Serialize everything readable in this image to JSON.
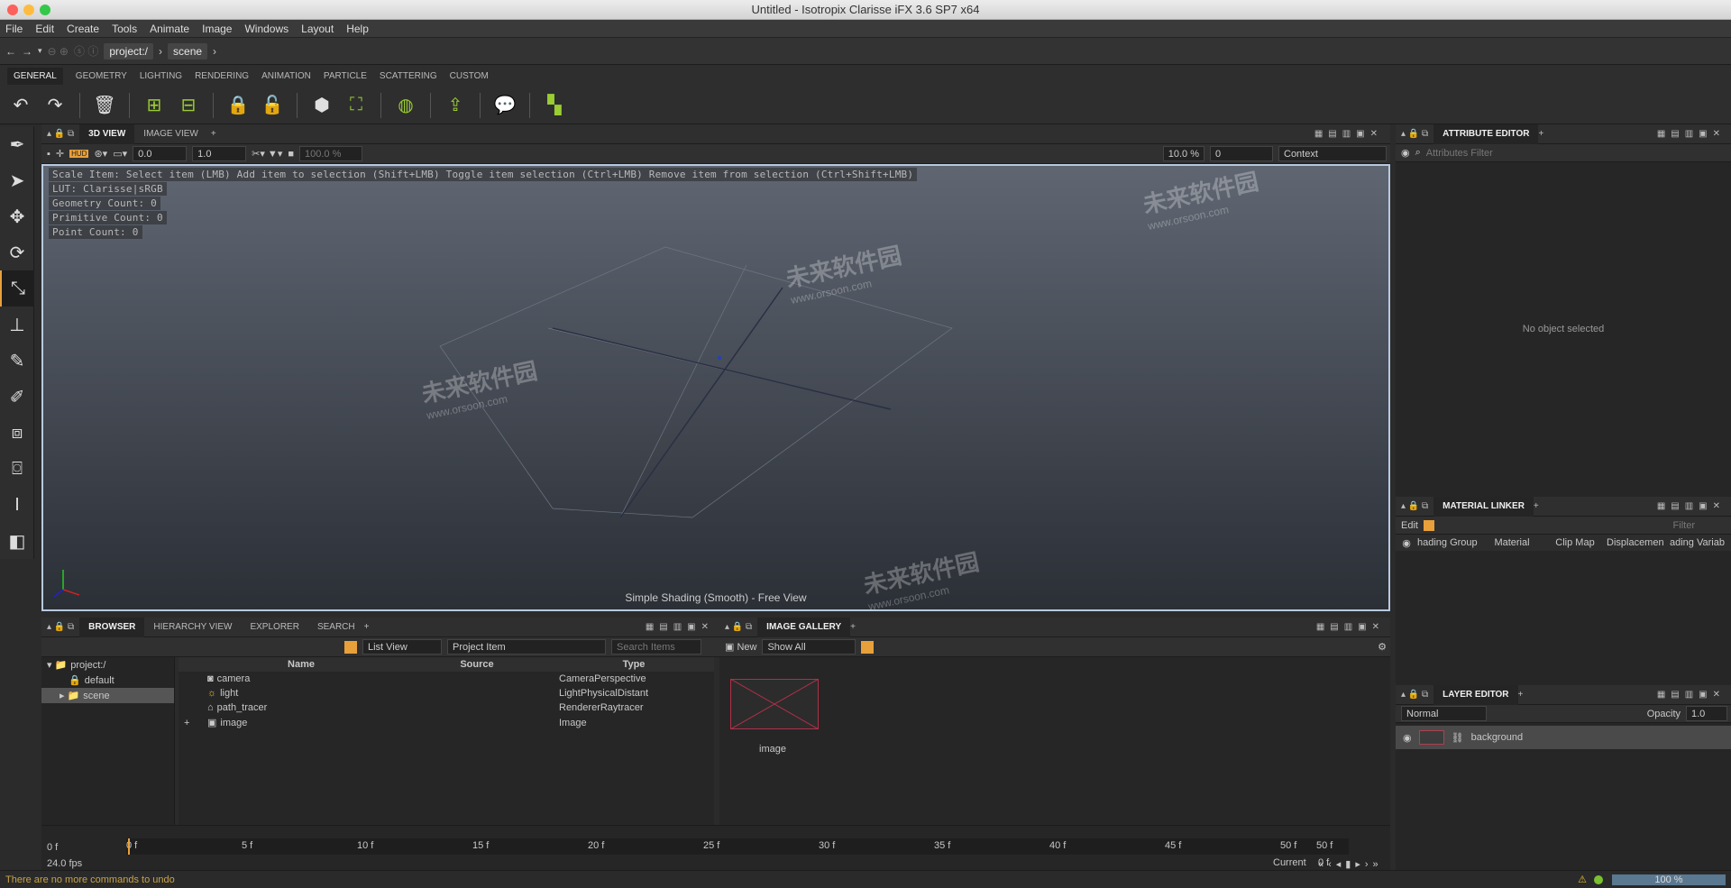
{
  "window": {
    "title": "Untitled - Isotropix Clarisse iFX 3.6 SP7 x64"
  },
  "menu": [
    "File",
    "Edit",
    "Create",
    "Tools",
    "Animate",
    "Image",
    "Windows",
    "Layout",
    "Help"
  ],
  "address": {
    "crumbs": [
      "project:/",
      "scene"
    ]
  },
  "shelf_tabs": [
    "GENERAL",
    "GEOMETRY",
    "LIGHTING",
    "RENDERING",
    "ANIMATION",
    "PARTICLE",
    "SCATTERING",
    "CUSTOM"
  ],
  "view_tabs": [
    "3D VIEW",
    "IMAGE VIEW"
  ],
  "view_toolbar": {
    "v1": "0.0",
    "v2": "1.0",
    "v3": "100.0 %",
    "pct": "10.0 %",
    "frame": "0",
    "context": "Context"
  },
  "hud": {
    "hint": "Scale Item: Select item (LMB)  Add item to selection (Shift+LMB)  Toggle item selection (Ctrl+LMB)  Remove item from selection (Ctrl+Shift+LMB)",
    "lut": "LUT: Clarisse|sRGB",
    "geometry": "Geometry Count: 0",
    "primitive": "Primitive Count: 0",
    "point": "Point Count: 0",
    "shading": "Simple Shading (Smooth) - Free View"
  },
  "watermark": {
    "cn": "未来软件园",
    "url": "www.orsoon.com"
  },
  "attribute_editor": {
    "title": "ATTRIBUTE EDITOR",
    "filter": "Attributes Filter",
    "empty": "No object selected"
  },
  "material_linker": {
    "title": "MATERIAL LINKER",
    "edit": "Edit",
    "filter": "Filter",
    "columns": [
      "hading Group",
      "Material",
      "Clip Map",
      "Displacemen",
      "ading Variab"
    ]
  },
  "layer_editor": {
    "title": "LAYER EDITOR",
    "mode": "Normal",
    "opacity_label": "Opacity",
    "opacity": "1.0",
    "layer": "background"
  },
  "browser": {
    "tabs": [
      "BROWSER",
      "HIERARCHY VIEW",
      "EXPLORER",
      "SEARCH"
    ],
    "list_view": "List View",
    "project_item": "Project Item",
    "search": "Search Items",
    "tree": [
      "project:/",
      "default",
      "scene"
    ],
    "columns": [
      "Name",
      "Source",
      "Type"
    ],
    "rows": [
      {
        "name": "camera",
        "source": "",
        "type": "CameraPerspective"
      },
      {
        "name": "light",
        "source": "",
        "type": "LightPhysicalDistant"
      },
      {
        "name": "path_tracer",
        "source": "",
        "type": "RendererRaytracer"
      },
      {
        "name": "image",
        "source": "",
        "type": "Image"
      }
    ]
  },
  "gallery": {
    "title": "IMAGE GALLERY",
    "new": "New",
    "show": "Show All",
    "item": "image"
  },
  "timeline": {
    "start": "0 f",
    "fps": "24.0 fps",
    "end": "50 f",
    "current_label": "Current",
    "current": "0 f",
    "ticks": [
      "0 f",
      "5 f",
      "10 f",
      "15 f",
      "20 f",
      "25 f",
      "30 f",
      "35 f",
      "40 f",
      "45 f",
      "50 f"
    ]
  },
  "status": {
    "message": "There are no more commands to undo",
    "zoom": "100 %"
  }
}
